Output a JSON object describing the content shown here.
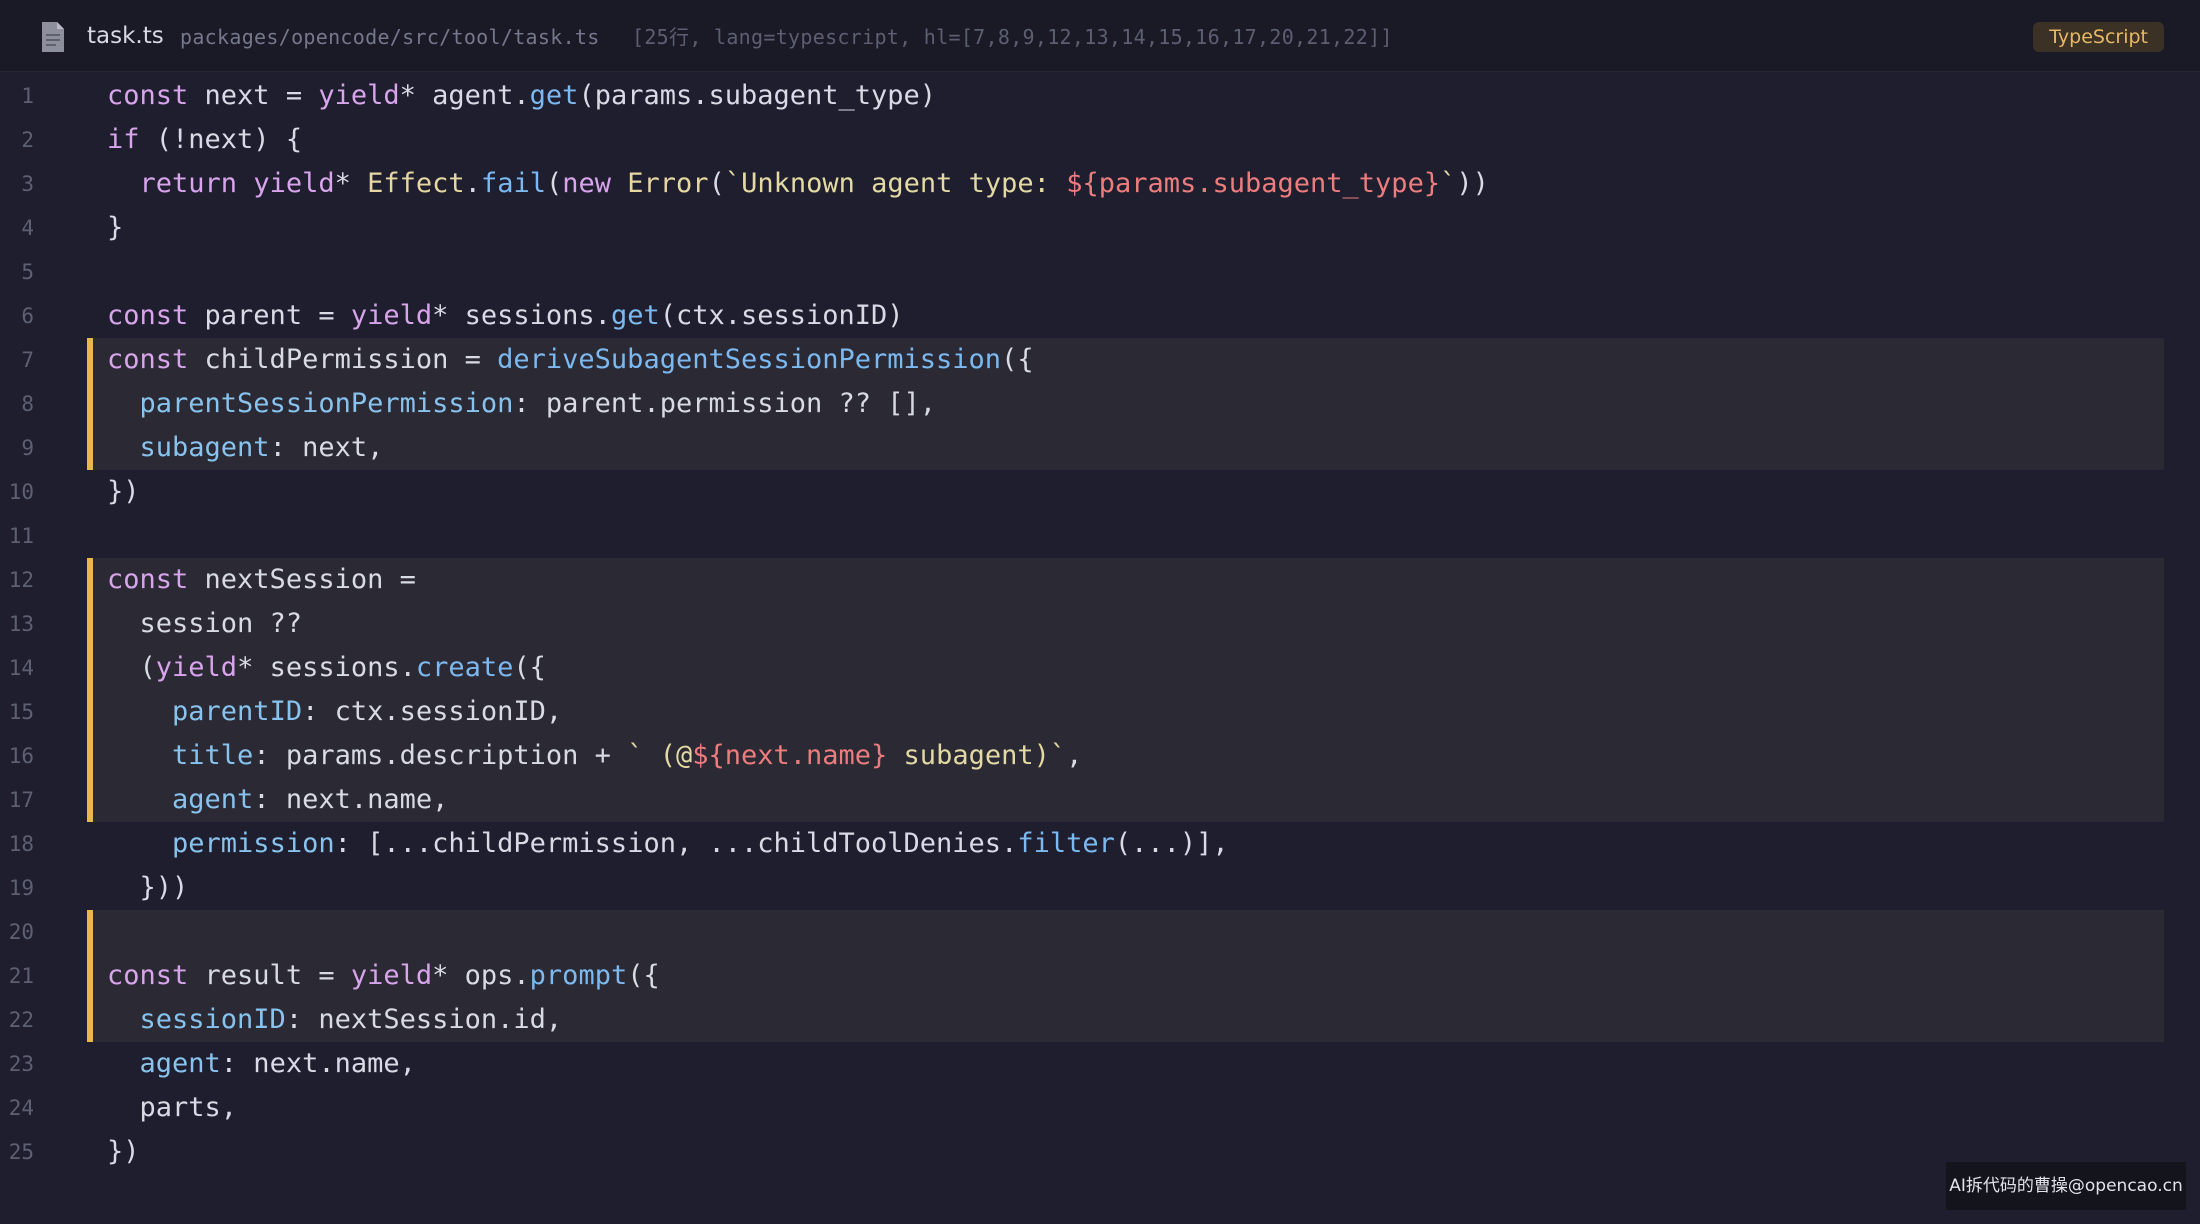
{
  "header": {
    "file_name": "task.ts",
    "file_path": "packages/opencode/src/tool/task.ts",
    "file_meta": "[25行, lang=typescript, hl=[7,8,9,12,13,14,15,16,17,20,21,22]]",
    "language_badge": "TypeScript",
    "icon": "file-icon"
  },
  "colors": {
    "background": "#1f1e2e",
    "highlight_bar": "#e9b84a",
    "badge_text": "#e8b864",
    "keyword": "#d8a4ec",
    "function": "#7cb9f0",
    "string": "#e2d9a4",
    "template_expr": "#ec7d7e"
  },
  "highlighted_lines": [
    7,
    8,
    9,
    12,
    13,
    14,
    15,
    16,
    17,
    20,
    21,
    22
  ],
  "lines": [
    {
      "n": "1",
      "tokens": [
        {
          "t": "const",
          "c": "kw"
        },
        {
          "t": " next = "
        },
        {
          "t": "yield",
          "c": "kw"
        },
        {
          "t": "* agent."
        },
        {
          "t": "get",
          "c": "fn"
        },
        {
          "t": "(params.subagent_type)"
        }
      ]
    },
    {
      "n": "2",
      "tokens": [
        {
          "t": "if",
          "c": "kw"
        },
        {
          "t": " (!next) {"
        }
      ]
    },
    {
      "n": "3",
      "tokens": [
        {
          "t": "  "
        },
        {
          "t": "return",
          "c": "kw"
        },
        {
          "t": " "
        },
        {
          "t": "yield",
          "c": "kw"
        },
        {
          "t": "* "
        },
        {
          "t": "Effect",
          "c": "cls"
        },
        {
          "t": "."
        },
        {
          "t": "fail",
          "c": "fn"
        },
        {
          "t": "("
        },
        {
          "t": "new",
          "c": "kw"
        },
        {
          "t": " "
        },
        {
          "t": "Error",
          "c": "cls"
        },
        {
          "t": "("
        },
        {
          "t": "`Unknown agent type: ",
          "c": "str"
        },
        {
          "t": "${params.subagent_type}",
          "c": "tpl"
        },
        {
          "t": "`",
          "c": "str"
        },
        {
          "t": "))"
        }
      ]
    },
    {
      "n": "4",
      "tokens": [
        {
          "t": "}"
        }
      ]
    },
    {
      "n": "5",
      "tokens": []
    },
    {
      "n": "6",
      "tokens": [
        {
          "t": "const",
          "c": "kw"
        },
        {
          "t": " parent = "
        },
        {
          "t": "yield",
          "c": "kw"
        },
        {
          "t": "* sessions."
        },
        {
          "t": "get",
          "c": "fn"
        },
        {
          "t": "(ctx.sessionID)"
        }
      ]
    },
    {
      "n": "7",
      "tokens": [
        {
          "t": "const",
          "c": "kw"
        },
        {
          "t": " childPermission = "
        },
        {
          "t": "deriveSubagentSessionPermission",
          "c": "fn"
        },
        {
          "t": "({"
        }
      ]
    },
    {
      "n": "8",
      "tokens": [
        {
          "t": "  "
        },
        {
          "t": "parentSessionPermission",
          "c": "prop"
        },
        {
          "t": ": parent.permission ?? [],"
        }
      ]
    },
    {
      "n": "9",
      "tokens": [
        {
          "t": "  "
        },
        {
          "t": "subagent",
          "c": "prop"
        },
        {
          "t": ": next,"
        }
      ]
    },
    {
      "n": "10",
      "tokens": [
        {
          "t": "})"
        }
      ]
    },
    {
      "n": "11",
      "tokens": []
    },
    {
      "n": "12",
      "tokens": [
        {
          "t": "const",
          "c": "kw"
        },
        {
          "t": " nextSession ="
        }
      ]
    },
    {
      "n": "13",
      "tokens": [
        {
          "t": "  session ??"
        }
      ]
    },
    {
      "n": "14",
      "tokens": [
        {
          "t": "  ("
        },
        {
          "t": "yield",
          "c": "kw"
        },
        {
          "t": "* sessions."
        },
        {
          "t": "create",
          "c": "fn"
        },
        {
          "t": "({"
        }
      ]
    },
    {
      "n": "15",
      "tokens": [
        {
          "t": "    "
        },
        {
          "t": "parentID",
          "c": "prop"
        },
        {
          "t": ": ctx.sessionID,"
        }
      ]
    },
    {
      "n": "16",
      "tokens": [
        {
          "t": "    "
        },
        {
          "t": "title",
          "c": "prop"
        },
        {
          "t": ": params.description + "
        },
        {
          "t": "` (@",
          "c": "str"
        },
        {
          "t": "${next.name}",
          "c": "tpl"
        },
        {
          "t": " subagent)`",
          "c": "str"
        },
        {
          "t": ","
        }
      ]
    },
    {
      "n": "17",
      "tokens": [
        {
          "t": "    "
        },
        {
          "t": "agent",
          "c": "prop"
        },
        {
          "t": ": next.name,"
        }
      ]
    },
    {
      "n": "18",
      "tokens": [
        {
          "t": "    "
        },
        {
          "t": "permission",
          "c": "prop"
        },
        {
          "t": ": [...childPermission, ...childToolDenies."
        },
        {
          "t": "filter",
          "c": "fn"
        },
        {
          "t": "(...)],"
        }
      ]
    },
    {
      "n": "19",
      "tokens": [
        {
          "t": "  }))"
        }
      ]
    },
    {
      "n": "20",
      "tokens": []
    },
    {
      "n": "21",
      "tokens": [
        {
          "t": "const",
          "c": "kw"
        },
        {
          "t": " result = "
        },
        {
          "t": "yield",
          "c": "kw"
        },
        {
          "t": "* ops."
        },
        {
          "t": "prompt",
          "c": "fn"
        },
        {
          "t": "({"
        }
      ]
    },
    {
      "n": "22",
      "tokens": [
        {
          "t": "  "
        },
        {
          "t": "sessionID",
          "c": "prop"
        },
        {
          "t": ": nextSession.id,"
        }
      ]
    },
    {
      "n": "23",
      "tokens": [
        {
          "t": "  "
        },
        {
          "t": "agent",
          "c": "prop"
        },
        {
          "t": ": next.name,"
        }
      ]
    },
    {
      "n": "24",
      "tokens": [
        {
          "t": "  parts,"
        }
      ]
    },
    {
      "n": "25",
      "tokens": [
        {
          "t": "})"
        }
      ]
    }
  ],
  "watermark": "AI拆代码的曹操@opencao.cn"
}
